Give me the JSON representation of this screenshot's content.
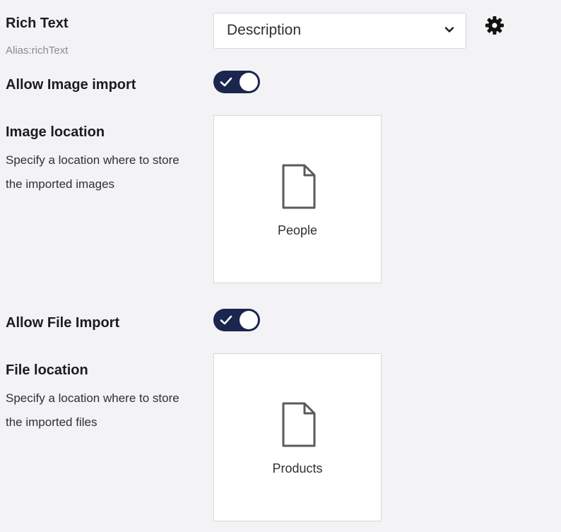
{
  "rich_text": {
    "label": "Rich Text",
    "alias": "Alias:richText",
    "selected_value": "Description",
    "chevron_icon": "chevron-down-icon",
    "settings_icon": "gear-icon"
  },
  "allow_image_import": {
    "label": "Allow Image import",
    "enabled": true
  },
  "image_location": {
    "label": "Image location",
    "description": "Specify a location where to store the imported images",
    "node_name": "People",
    "node_icon": "document-icon"
  },
  "allow_file_import": {
    "label": "Allow File Import",
    "enabled": true
  },
  "file_location": {
    "label": "File location",
    "description": "Specify a location where to store the imported files",
    "node_name": "Products",
    "node_icon": "document-icon"
  },
  "colors": {
    "accent": "#1b264f",
    "background": "#f3f3f5",
    "card": "#ffffff"
  }
}
